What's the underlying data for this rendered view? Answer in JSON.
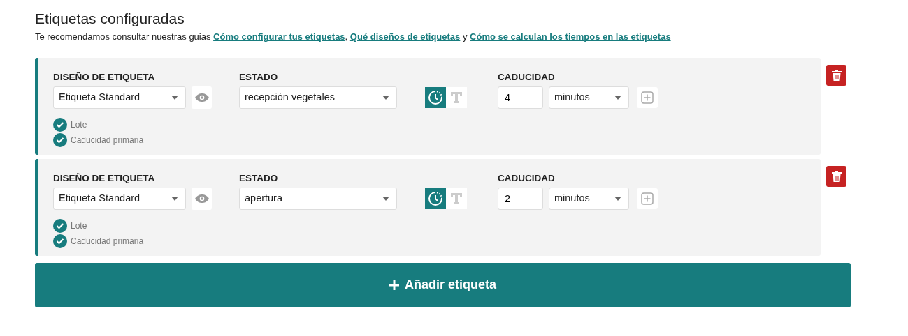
{
  "title": "Etiquetas configuradas",
  "intro": [
    {
      "kind": "text",
      "text": "Te recomendamos consultar nuestras guias "
    },
    {
      "kind": "link",
      "text": "Cómo configurar tus etiquetas"
    },
    {
      "kind": "text",
      "text": ", "
    },
    {
      "kind": "link",
      "text": "Qué diseños de etiquetas"
    },
    {
      "kind": "text",
      "text": " y "
    },
    {
      "kind": "link",
      "text": "Cómo se calculan los tiempos en las etiquetas"
    }
  ],
  "labels": [
    {
      "design_label": "DISEÑO DE ETIQUETA",
      "design": "Etiqueta Standard",
      "state_label": "ESTADO",
      "state": "recepción vegetales",
      "time_mode": [
        {
          "kind": "clock",
          "selected": true
        },
        {
          "kind": "text",
          "selected": false
        }
      ],
      "expiry_label": "CADUCIDAD",
      "expiry_value": "4",
      "expiry_unit": "minutos",
      "options": [
        {
          "label": "Lote",
          "checked": true
        },
        {
          "label": "Caducidad primaria",
          "checked": true
        }
      ]
    },
    {
      "design_label": "DISEÑO DE ETIQUETA",
      "design": "Etiqueta Standard",
      "state_label": "ESTADO",
      "state": "apertura",
      "time_mode": [
        {
          "kind": "clock",
          "selected": true
        },
        {
          "kind": "text",
          "selected": false
        }
      ],
      "expiry_label": "CADUCIDAD",
      "expiry_value": "2",
      "expiry_unit": "minutos",
      "options": [
        {
          "label": "Lote",
          "checked": true
        },
        {
          "label": "Caducidad primaria",
          "checked": true
        }
      ]
    }
  ],
  "add_button": "Añadir etiqueta"
}
